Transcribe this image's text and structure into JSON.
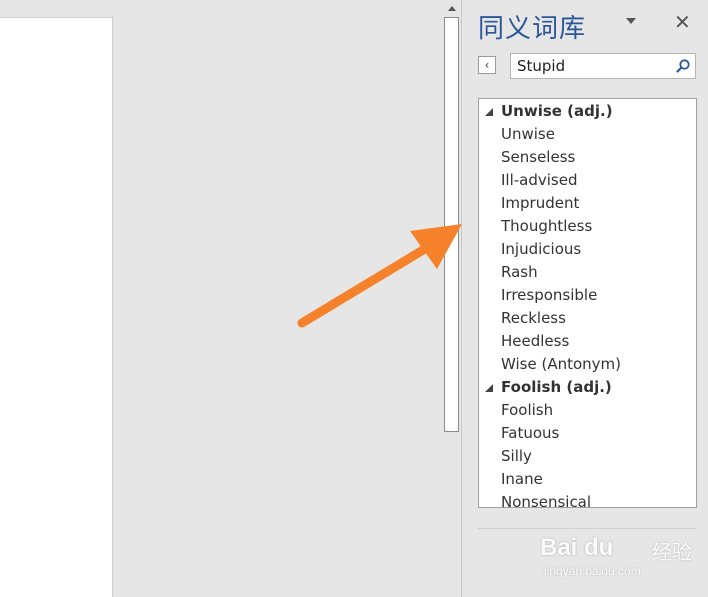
{
  "pane": {
    "title": "同义词库",
    "close_glyph": "✕",
    "back_glyph": "‹"
  },
  "search": {
    "value": "Stupid"
  },
  "results": [
    {
      "type": "head",
      "label": "Unwise (adj.)"
    },
    {
      "type": "word",
      "label": "Unwise"
    },
    {
      "type": "word",
      "label": "Senseless"
    },
    {
      "type": "word",
      "label": "Ill-advised"
    },
    {
      "type": "word",
      "label": "Imprudent"
    },
    {
      "type": "word",
      "label": "Thoughtless"
    },
    {
      "type": "word",
      "label": "Injudicious"
    },
    {
      "type": "word",
      "label": "Rash"
    },
    {
      "type": "word",
      "label": "Irresponsible"
    },
    {
      "type": "word",
      "label": "Reckless"
    },
    {
      "type": "word",
      "label": "Heedless"
    },
    {
      "type": "word",
      "label": "Wise (Antonym)"
    },
    {
      "type": "head",
      "label": "Foolish (adj.)"
    },
    {
      "type": "word",
      "label": "Foolish"
    },
    {
      "type": "word",
      "label": "Fatuous"
    },
    {
      "type": "word",
      "label": "Silly"
    },
    {
      "type": "word",
      "label": "Inane"
    },
    {
      "type": "word",
      "label": "Nonsensical"
    }
  ],
  "watermark": {
    "brand": "Bai  du",
    "cn": "经验",
    "sub": "jingyan.baidu.com"
  },
  "colors": {
    "accent": "#2b579a",
    "annotation_arrow": "#f5822a"
  },
  "icons": {
    "search": "search-icon",
    "close": "close-icon",
    "menu": "chevron-down-icon",
    "back": "chevron-left-icon",
    "collapse": "collapse-triangle-icon",
    "scroll_up": "scroll-up-arrow-icon"
  }
}
